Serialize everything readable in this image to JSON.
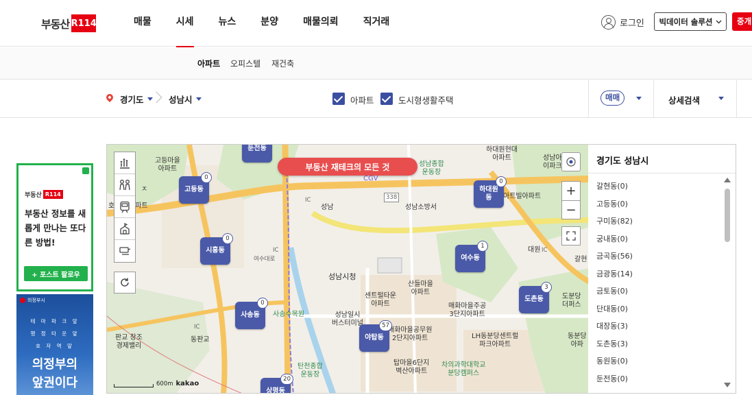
{
  "header": {
    "logo_text": "부동산",
    "logo_badge": "R114",
    "nav": [
      "매물",
      "시세",
      "뉴스",
      "분양",
      "매물의뢰",
      "직거래"
    ],
    "active_nav": "시세",
    "login": "로그인",
    "bigdata": "빅데이터 솔루션",
    "agent": "중개"
  },
  "subnav": {
    "items": [
      "아파트",
      "오피스텔",
      "재건축"
    ],
    "active": "아파트"
  },
  "filter": {
    "region1": "경기도",
    "region2": "성남시",
    "check1": "아파트",
    "check2": "도시형생활주택",
    "trade": "매매",
    "detail": "상세검색"
  },
  "ads": {
    "ad1_logo": "부동산",
    "ad1_logo_badge": "R114",
    "ad1_text": "부동산 정보를 새롭게 만나는 또다른 방법!",
    "ad1_button": "+ 포스트 팔로우",
    "ad2_brand": "의정부시",
    "ad2_lines": [
      "테 마 파 크 앞",
      "행 정 타 운 앞",
      "호 자 역 앞"
    ],
    "ad2_big1": "의정부의",
    "ad2_big2": "앞권이다"
  },
  "map": {
    "banner": "부동산 재테크의 모든 것",
    "scale": "600m",
    "kakao": "kakao",
    "markers": [
      {
        "name": "둔전동",
        "count": ""
      },
      {
        "name": "고등동",
        "count": "0"
      },
      {
        "name": "시흥동",
        "count": "0"
      },
      {
        "name": "사송동",
        "count": "0"
      },
      {
        "name": "여수동",
        "count": "1"
      },
      {
        "name": "하대원\n동",
        "count": "0"
      },
      {
        "name": "도촌동",
        "count": "3"
      },
      {
        "name": "야탑동",
        "count": "57"
      },
      {
        "name": "상평동",
        "count": "20"
      }
    ],
    "labels": [
      "고등마을\n아파트",
      "아파트",
      "CGV",
      "성남종합\n운동장",
      "하대원현대\n아파트",
      "성남아\n이파크",
      "성남소방서",
      "성남",
      "여수대로",
      "성남시청",
      "산들마을\n아파트",
      "센트럴타운\n아파트",
      "매화마을주공\n3단지아파트",
      "사송수목원",
      "성남일시\n버스터미널",
      "매화마을공무원\n2단지아파트",
      "LH동분당센트럴\n파크아파트",
      "탑마을6단지\n벽산아파트",
      "차의과학대학교\n분당캠퍼스",
      "판교 창조\n경제밸리",
      "동판교",
      "대원",
      "갈현",
      "도분당\n더퍼스",
      "동분당\n아파",
      "탄천종합\n운동장",
      "아트빌아파트",
      "338",
      "IC",
      "IC",
      "IC",
      "IC",
      "호",
      "ㅈ"
    ]
  },
  "panel": {
    "title": "경기도 성남시",
    "items": [
      "갈현동(0)",
      "고등동(0)",
      "구미동(82)",
      "궁내동(0)",
      "금곡동(56)",
      "금광동(14)",
      "금토동(0)",
      "단대동(0)",
      "대장동(3)",
      "도촌동(3)",
      "동원동(0)",
      "둔전동(0)"
    ]
  },
  "colors": {
    "brand": "#e60012",
    "accent": "#3a4fa0",
    "marker": "#4a5aa8",
    "banner": "#e84e4e",
    "ad_green": "#22b14c"
  }
}
